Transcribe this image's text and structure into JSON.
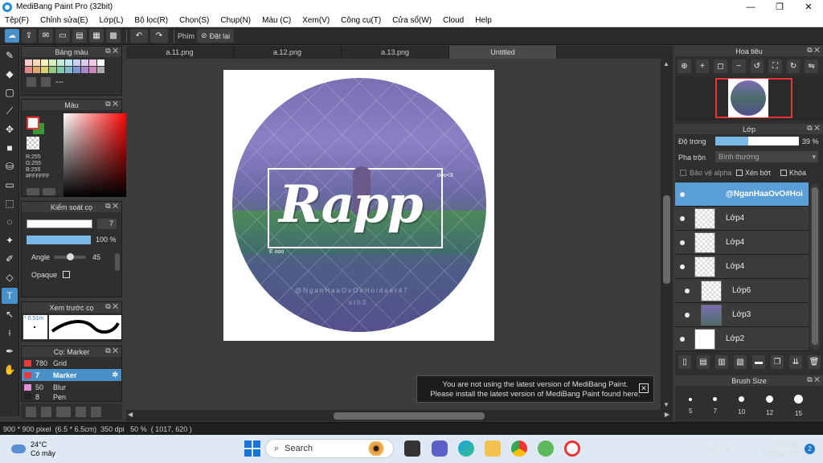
{
  "window": {
    "title": "MediBang Paint Pro (32bit)",
    "minimize": "—",
    "maximize": "❐",
    "close": "✕"
  },
  "menu": [
    "Tệp(F)",
    "Chỉnh sửa(E)",
    "Lớp(L)",
    "Bộ lọc(R)",
    "Chọn(S)",
    "Chụp(N)",
    "Màu (C)",
    "Xem(V)",
    "Công cụ(T)",
    "Cửa sổ(W)",
    "Cloud",
    "Help"
  ],
  "toolbar": {
    "key_label": "Phím",
    "reset_label": "Đặt lại"
  },
  "palette_panel": {
    "title": "Bảng màu",
    "dots": "---"
  },
  "color_panel": {
    "title": "Màu",
    "r": "R:255",
    "g": "G:255",
    "b": "B:255",
    "hex": "#FFFFFF"
  },
  "brush_control": {
    "title": "Kiểm soát cọ",
    "size": "7",
    "opacity": "100 %",
    "angle_label": "Angle",
    "angle_value": "45",
    "opaque_label": "Opaque"
  },
  "brush_preview": {
    "title": "Xem trước cọ",
    "size": "* 0.51m"
  },
  "brush_list": {
    "title": "Cọ: Marker",
    "items": [
      {
        "num": "780",
        "name": "Grid",
        "color": "#e8393b"
      },
      {
        "num": "7",
        "name": "Marker",
        "color": "#e8393b"
      },
      {
        "num": "50",
        "name": "Blur",
        "color": "#e48ed8"
      },
      {
        "num": "8",
        "name": "Pen",
        "color": "#222222"
      }
    ]
  },
  "tabs": [
    "a.11.png",
    "a.12.png",
    "a.13.png",
    "Untitled"
  ],
  "artwork": {
    "title": "Rapp",
    "tag_top": "ooo<3",
    "tag_bottom": "E ooo",
    "watermark": "@NganHaaOvO#Hoidaer47",
    "watermark2": "sth3"
  },
  "toast": {
    "line1": "You are not using the latest version of MediBang Paint.",
    "line2": "Please install the latest version of MediBang Paint found here."
  },
  "status": {
    "size": "900 * 900 pixel",
    "cm": "(6.5 * 6.5cm)",
    "dpi": "350 dpi",
    "zoom": "50 %",
    "coords": "( 1017, 620 )"
  },
  "navigator": {
    "title": "Hoa tiêu"
  },
  "layers": {
    "title": "Lớp",
    "opacity_label": "Độ trong",
    "opacity_value": "39 %",
    "opacity_fraction": 0.39,
    "blend_label": "Pha trộn",
    "blend_value": "Bình thường",
    "protect_alpha": "Bảo vệ alpha",
    "clip": "Xén bớt",
    "lock": "Khóa",
    "items": [
      {
        "name": "@NganHaaOvO#Hoi",
        "selected": true
      },
      {
        "name": "Lớp4",
        "selected": false
      },
      {
        "name": "Lớp4",
        "selected": false
      },
      {
        "name": "Lớp4",
        "selected": false
      },
      {
        "name": "Lớp6",
        "selected": false
      },
      {
        "name": "Lớp3",
        "selected": false
      },
      {
        "name": "Lớp2",
        "selected": false
      }
    ]
  },
  "brush_size": {
    "title": "Brush Size",
    "sizes": [
      "5",
      "7",
      "10",
      "12",
      "15"
    ]
  },
  "taskbar": {
    "temp": "24°C",
    "weather": "Có mây",
    "search": "Search",
    "lang": "VIE",
    "time": "12:34 AM",
    "date": "10/15/2023",
    "notif": "2"
  }
}
